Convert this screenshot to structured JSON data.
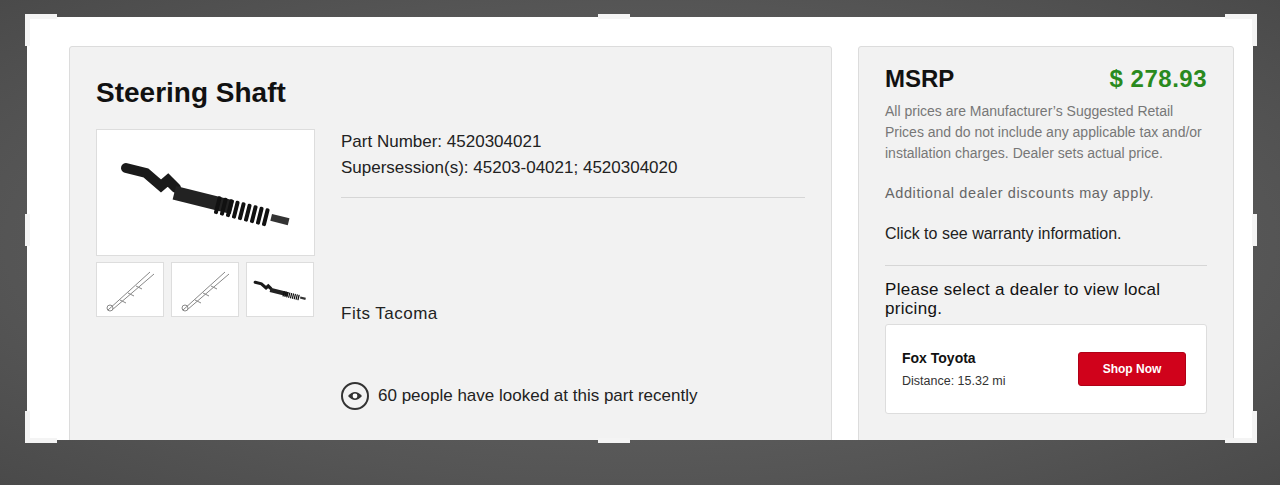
{
  "product": {
    "title": "Steering Shaft",
    "part_number": "Part Number: 4520304021",
    "supersessions": "Supersession(s): 45203-04021; 4520304020",
    "fits": "Fits Tacoma",
    "views": "60 people have looked at this part recently",
    "thumbnails": [
      {
        "kind": "drawing"
      },
      {
        "kind": "drawing"
      },
      {
        "kind": "photo"
      }
    ]
  },
  "pricing": {
    "label": "MSRP",
    "price": "$ 278.93",
    "disclaimer": "All prices are Manufacturer’s Suggested Retail Prices and do not include any applicable tax and/or installation charges. Dealer sets actual price.",
    "discounts": "Additional dealer discounts may apply.",
    "warranty": "Click to see warranty information.",
    "select_prompt": "Please select a dealer to view local pricing.",
    "dealers": [
      {
        "name": "Fox Toyota",
        "distance": "Distance: 15.32 mi",
        "button": "Shop Now"
      }
    ]
  }
}
